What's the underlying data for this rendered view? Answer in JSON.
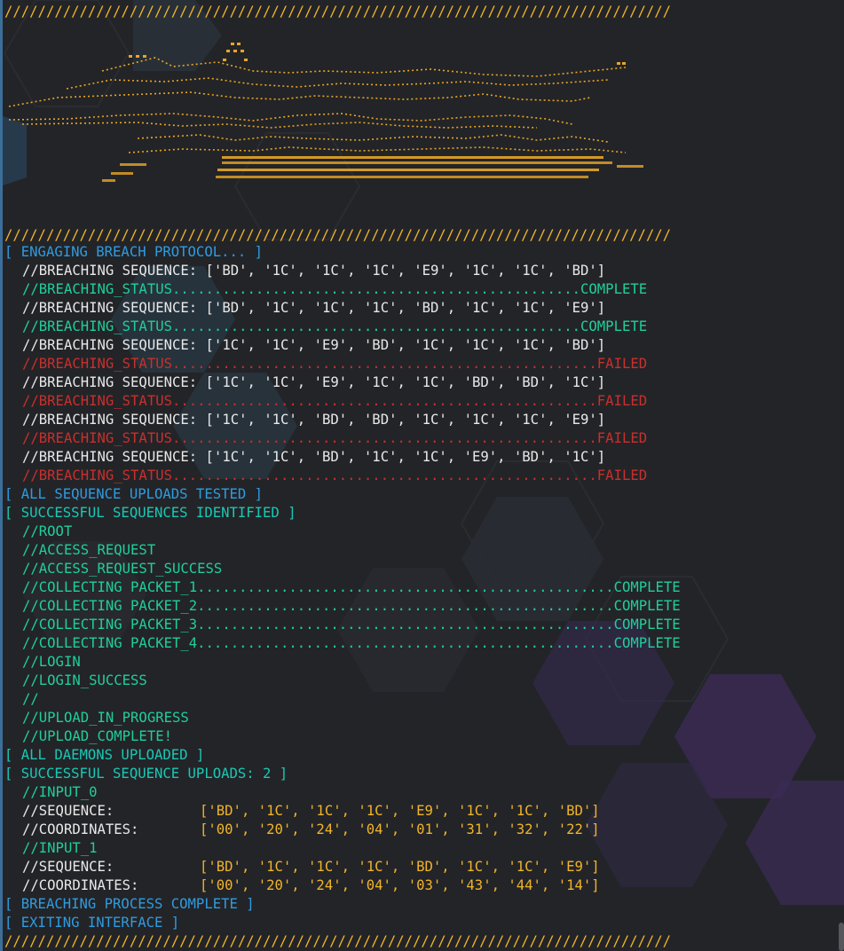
{
  "separator": "////////////////////////////////////////////////////////////////////////////////",
  "header": {
    "engaging": "[ ENGAGING BREACH PROTOCOL... ]"
  },
  "attempts": [
    {
      "sequence": "//BREACHING SEQUENCE: ['BD', '1C', '1C', '1C', 'E9', '1C', '1C', 'BD']",
      "status_label": "//BREACHING_STATUS.................................................",
      "status": "COMPLETE"
    },
    {
      "sequence": "//BREACHING SEQUENCE: ['BD', '1C', '1C', '1C', 'BD', '1C', '1C', 'E9']",
      "status_label": "//BREACHING_STATUS.................................................",
      "status": "COMPLETE"
    },
    {
      "sequence": "//BREACHING SEQUENCE: ['1C', '1C', 'E9', 'BD', '1C', '1C', '1C', 'BD']",
      "status_label": "//BREACHING_STATUS...................................................",
      "status": "FAILED"
    },
    {
      "sequence": "//BREACHING SEQUENCE: ['1C', '1C', 'E9', '1C', '1C', 'BD', 'BD', '1C']",
      "status_label": "//BREACHING_STATUS...................................................",
      "status": "FAILED"
    },
    {
      "sequence": "//BREACHING SEQUENCE: ['1C', '1C', 'BD', 'BD', '1C', '1C', '1C', 'E9']",
      "status_label": "//BREACHING_STATUS...................................................",
      "status": "FAILED"
    },
    {
      "sequence": "//BREACHING SEQUENCE: ['1C', '1C', 'BD', '1C', '1C', 'E9', 'BD', '1C']",
      "status_label": "//BREACHING_STATUS...................................................",
      "status": "FAILED"
    }
  ],
  "all_tested": "[ ALL SEQUENCE UPLOADS TESTED ]",
  "identified": "[ SUCCESSFUL SEQUENCES IDENTIFIED ]",
  "steps": {
    "root": "//ROOT",
    "access_request": "//ACCESS_REQUEST",
    "access_success": "//ACCESS_REQUEST_SUCCESS",
    "packets": [
      {
        "label": "//COLLECTING PACKET_1..................................................",
        "status": "COMPLETE"
      },
      {
        "label": "//COLLECTING PACKET_2..................................................",
        "status": "COMPLETE"
      },
      {
        "label": "//COLLECTING PACKET_3..................................................",
        "status": "COMPLETE"
      },
      {
        "label": "//COLLECTING PACKET_4..................................................",
        "status": "COMPLETE"
      }
    ],
    "login": "//LOGIN",
    "login_success": "//LOGIN_SUCCESS",
    "blank": "//",
    "upload_progress": "//UPLOAD_IN_PROGRESS",
    "upload_complete": "//UPLOAD_COMPLETE!"
  },
  "daemons": "[ ALL DAEMONS UPLOADED ]",
  "successful_uploads": "[ SUCCESSFUL SEQUENCE UPLOADS: 2 ]",
  "inputs": [
    {
      "name": "//INPUT_0",
      "seq_label": "//SEQUENCE:",
      "seq_value": "['BD', '1C', '1C', '1C', 'E9', '1C', '1C', 'BD']",
      "coord_label": "//COORDINATES:",
      "coord_value": "['00', '20', '24', '04', '01', '31', '32', '22']"
    },
    {
      "name": "//INPUT_1",
      "seq_label": "//SEQUENCE:",
      "seq_value": "['BD', '1C', '1C', '1C', 'BD', '1C', '1C', 'E9']",
      "coord_label": "//COORDINATES:",
      "coord_value": "['00', '20', '24', '04', '03', '43', '44', '14']"
    }
  ],
  "process_complete": "[ BREACHING PROCESS COMPLETE ]",
  "exiting": "[ EXITING INTERFACE ]",
  "colors": {
    "white": "#e8e8e8",
    "yellow": "#f0b429",
    "green": "#1fcf9a",
    "red": "#c9302c",
    "blue": "#2e9ce0",
    "cyan": "#18c9b5"
  }
}
